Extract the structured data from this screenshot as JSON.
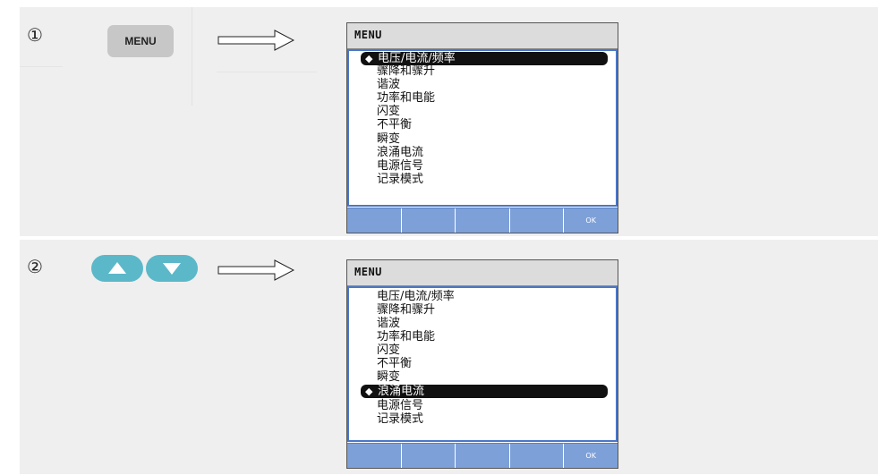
{
  "step1": {
    "number": "①",
    "button_label": "MENU",
    "screen": {
      "title": "MENU",
      "items": [
        "电压/电流/频率",
        "骤降和骤升",
        "谐波",
        "功率和电能",
        "闪变",
        "不平衡",
        "瞬变",
        "浪涌电流",
        "电源信号",
        "记录模式"
      ],
      "selected_index": 0,
      "softkeys": [
        "",
        "",
        "",
        "",
        "OK"
      ]
    }
  },
  "step2": {
    "number": "②",
    "screen": {
      "title": "MENU",
      "items": [
        "电压/电流/频率",
        "骤降和骤升",
        "谐波",
        "功率和电能",
        "闪变",
        "不平衡",
        "瞬变",
        "浪涌电流",
        "电源信号",
        "记录模式"
      ],
      "selected_index": 7,
      "softkeys": [
        "",
        "",
        "",
        "",
        "OK"
      ]
    }
  },
  "icons": {
    "selection_marker": "up-down-arrow-icon",
    "nav_up": "up-arrow-button",
    "nav_down": "down-arrow-button",
    "flow_arrow": "right-arrow-icon"
  },
  "colors": {
    "panel_bg": "#efefef",
    "nav_button": "#5bb8c9",
    "softkey_bar": "#7ea0d8",
    "list_border": "#4a77c9",
    "selection": "#111111"
  }
}
